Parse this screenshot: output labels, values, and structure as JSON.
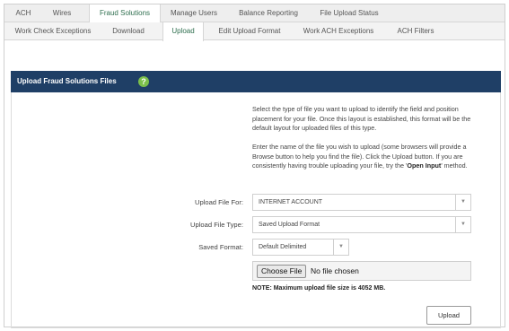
{
  "tabs_primary": [
    "ACH",
    "Wires",
    "Fraud Solutions",
    "Manage Users",
    "Balance Reporting",
    "File Upload Status"
  ],
  "tabs_secondary": [
    "Work Check Exceptions",
    "Download",
    "Upload",
    "Edit Upload Format",
    "Work ACH Exceptions",
    "ACH Filters"
  ],
  "header": {
    "title": "Upload Fraud Solutions Files",
    "help_glyph": "?"
  },
  "description": {
    "para1": "Select the type of file you want to upload to identify the field and position placement for your file. Once this layout is established, this format will be the default layout for uploaded files of this type.",
    "para2_a": "Enter the name of the file you wish to upload (some browsers will provide a Browse button to help you find the file). Click the Upload button. If you are consistently having trouble uploading your file, try the '",
    "para2_bold": "Open Input",
    "para2_c": "' method."
  },
  "form": {
    "upload_for_label": "Upload File For:",
    "upload_for_value": "INTERNET ACCOUNT",
    "file_type_label": "Upload File Type:",
    "file_type_value": "Saved Upload Format",
    "saved_format_label": "Saved Format:",
    "saved_format_value": "Default Delimited",
    "choose_file_label": "Choose File",
    "no_file_text": "No file chosen",
    "note": "NOTE: Maximum upload file size is 4052 MB.",
    "upload_button": "Upload"
  },
  "colors": {
    "header_bg": "#1f3f66",
    "active_tab_text": "#2f6f4f",
    "help_icon": "#7cc04b"
  },
  "icons": {
    "dropdown": "caret-down-icon",
    "help": "help-circle-icon"
  }
}
